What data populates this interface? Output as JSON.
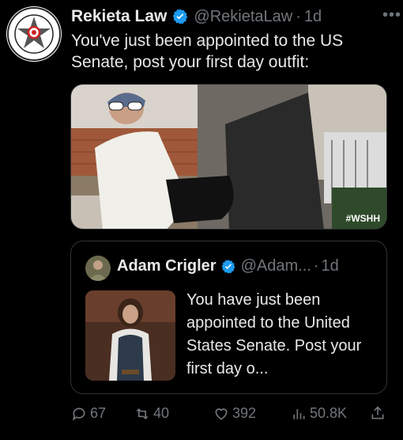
{
  "tweet": {
    "author_name": "Rekieta Law",
    "handle": "@RekietaLaw",
    "separator": "·",
    "time": "1d",
    "more": "•••",
    "text": "You've just been appointed to the US Senate, post your first day outfit:",
    "avatar_icon": "badge-star-logo",
    "avatar_ring_text": "YOUTUBE LAWYER · INTOXICATION & LITIGATION"
  },
  "media": {
    "watermark": "#WSHH"
  },
  "quote": {
    "author_name": "Adam Crigler",
    "handle": "@Adam...",
    "separator": "·",
    "time": "1d",
    "text": "You have just been appointed to the United States Senate. Post your first day o..."
  },
  "actions": {
    "replies": "67",
    "reposts": "40",
    "likes": "392",
    "views": "50.8K"
  },
  "colors": {
    "background": "#000000",
    "text": "#e7e9ea",
    "muted": "#71767b",
    "verified": "#1d9bf0",
    "border": "#2f3336"
  }
}
